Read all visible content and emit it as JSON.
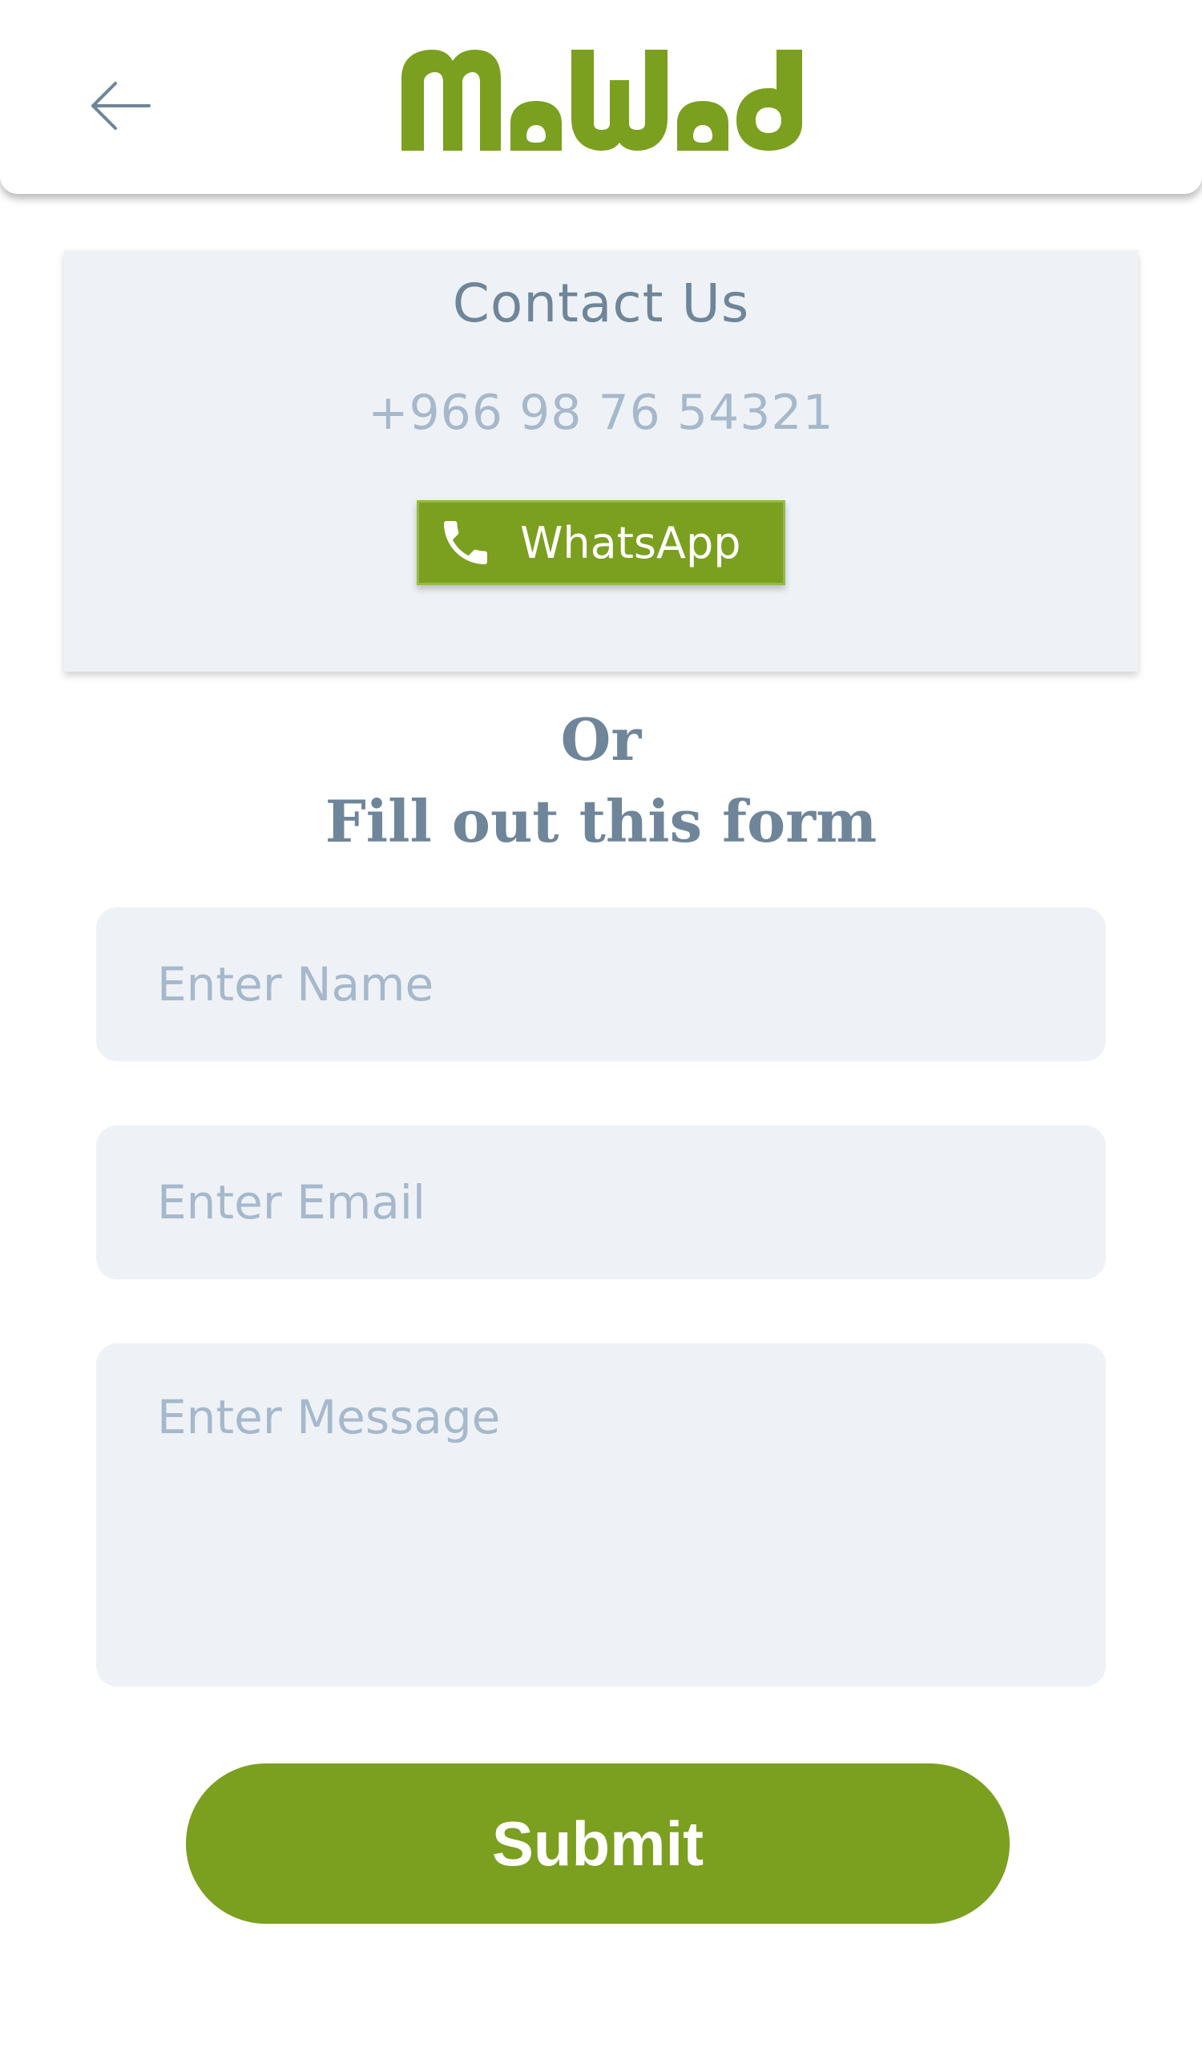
{
  "header": {
    "back_icon": "arrow-left-icon",
    "logo_text": "MaWaD",
    "brand_color": "#7b9f1f"
  },
  "contact": {
    "title": "Contact Us",
    "phone": "+966 98 76 54321",
    "whatsapp_label": "WhatsApp",
    "whatsapp_icon": "phone-icon"
  },
  "form": {
    "or_text": "Or",
    "heading": "Fill out this form",
    "name_placeholder": "Enter Name",
    "email_placeholder": "Enter Email",
    "message_placeholder": "Enter Message",
    "submit_label": "Submit"
  },
  "colors": {
    "accent": "#7b9f1f",
    "card_bg": "#eef2f6",
    "heading_text": "#6f8599",
    "placeholder_text": "#a6b8cc"
  }
}
